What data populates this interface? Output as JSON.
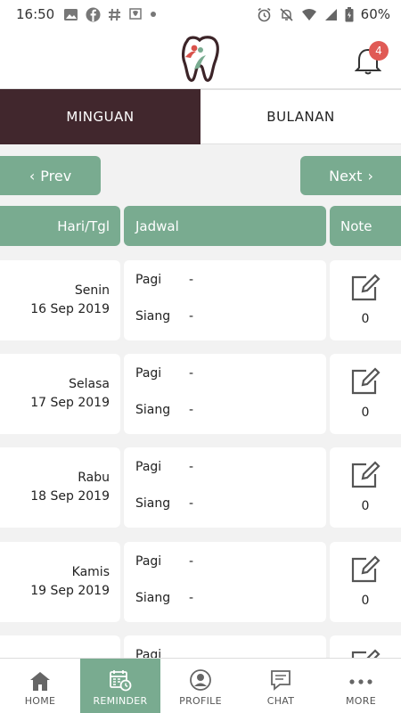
{
  "status_bar": {
    "time": "16:50",
    "battery_pct": "60%"
  },
  "header": {
    "notification_count": "4",
    "logo_icon": "tooth-logo-icon",
    "bell_icon": "bell-icon"
  },
  "tabs": [
    {
      "label": "MINGUAN",
      "active": true
    },
    {
      "label": "BULANAN",
      "active": false
    }
  ],
  "pager": {
    "prev_label": "Prev",
    "next_label": "Next"
  },
  "table": {
    "headers": {
      "hari": "Hari/Tgl",
      "jadwal": "Jadwal",
      "note": "Note"
    },
    "rows": [
      {
        "day": "Senin",
        "date": "16 Sep 2019",
        "pagi_label": "Pagi",
        "pagi_value": "-",
        "siang_label": "Siang",
        "siang_value": "-",
        "note_count": "0"
      },
      {
        "day": "Selasa",
        "date": "17 Sep 2019",
        "pagi_label": "Pagi",
        "pagi_value": "-",
        "siang_label": "Siang",
        "siang_value": "-",
        "note_count": "0"
      },
      {
        "day": "Rabu",
        "date": "18 Sep 2019",
        "pagi_label": "Pagi",
        "pagi_value": "-",
        "siang_label": "Siang",
        "siang_value": "-",
        "note_count": "0"
      },
      {
        "day": "Kamis",
        "date": "19 Sep 2019",
        "pagi_label": "Pagi",
        "pagi_value": "-",
        "siang_label": "Siang",
        "siang_value": "-",
        "note_count": "0"
      },
      {
        "day": "",
        "date": "",
        "pagi_label": "Pagi",
        "pagi_value": "",
        "siang_label": "",
        "siang_value": "",
        "note_count": ""
      }
    ]
  },
  "bottom_nav": [
    {
      "label": "HOME",
      "icon": "home-icon",
      "active": false
    },
    {
      "label": "REMINDER",
      "icon": "calendar-clock-icon",
      "active": true
    },
    {
      "label": "PROFILE",
      "icon": "profile-icon",
      "active": false
    },
    {
      "label": "CHAT",
      "icon": "chat-icon",
      "active": false
    },
    {
      "label": "MORE",
      "icon": "more-icon",
      "active": false
    }
  ],
  "colors": {
    "accent_green": "#79ab90",
    "tab_active": "#41272d",
    "badge_red": "#e05a55"
  }
}
